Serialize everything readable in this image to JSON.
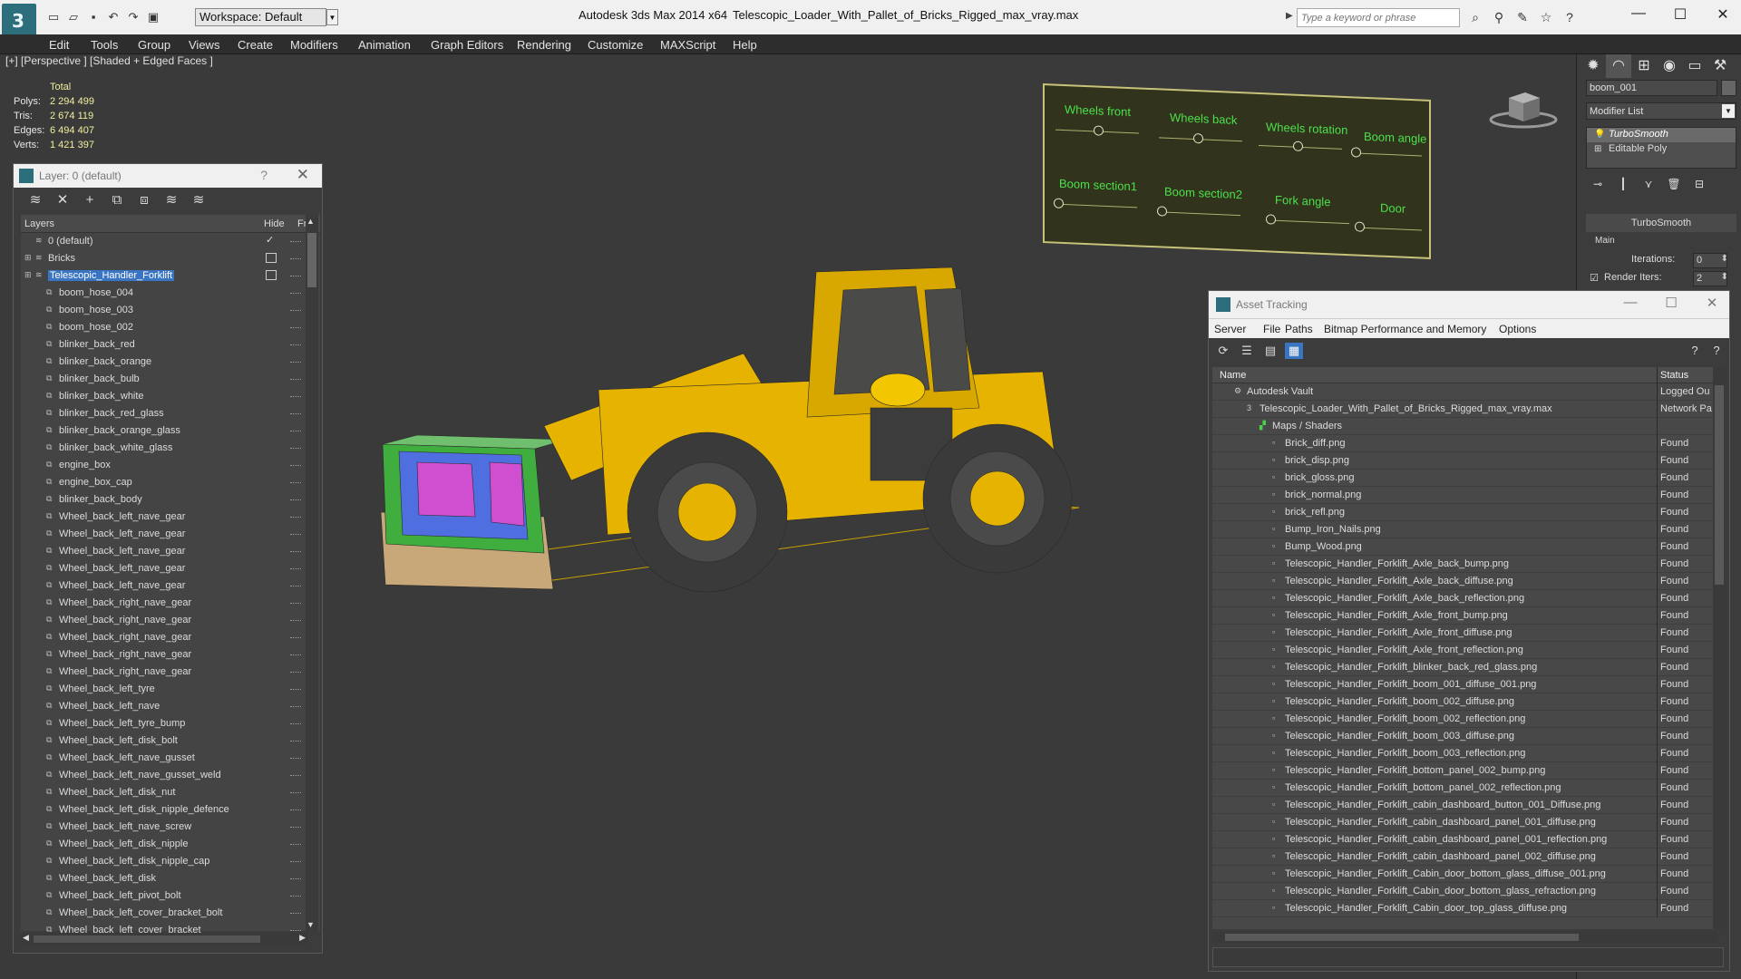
{
  "titlebar": {
    "workspace": "Workspace: Default",
    "app_title": "Autodesk 3ds Max  2014 x64",
    "file_title": "Telescopic_Loader_With_Pallet_of_Bricks_Rigged_max_vray.max",
    "search_placeholder": "Type a keyword or phrase"
  },
  "menu": [
    "Edit",
    "Tools",
    "Group",
    "Views",
    "Create",
    "Modifiers",
    "Animation",
    "Graph Editors",
    "Rendering",
    "Customize",
    "MAXScript",
    "Help"
  ],
  "viewport": {
    "label": "[+] [Perspective ] [Shaded + Edged Faces ]",
    "stats": {
      "header": "Total",
      "rows": [
        {
          "k": "Polys:",
          "v": "2 294 499"
        },
        {
          "k": "Tris:",
          "v": "2 674 119"
        },
        {
          "k": "Edges:",
          "v": "6 494 407"
        },
        {
          "k": "Verts:",
          "v": "1 421 397"
        }
      ]
    }
  },
  "rig_panel": {
    "labels": [
      "Wheels front",
      "Wheels back",
      "Wheels rotation",
      "Boom angle",
      "Boom section1",
      "Boom section2",
      "Fork angle",
      "Door"
    ]
  },
  "layer_dialog": {
    "title": "Layer: 0 (default)",
    "help": "?",
    "columns": {
      "layers": "Layers",
      "hide": "Hide",
      "freeze": "Fr"
    },
    "layers": [
      {
        "name": "0 (default)",
        "level": 0,
        "hide": "check"
      },
      {
        "name": "Bricks",
        "level": 0,
        "hide": "box",
        "expand": true
      },
      {
        "name": "Telescopic_Handler_Forklift",
        "level": 0,
        "hide": "box",
        "expand": true,
        "selected": true
      },
      {
        "name": "boom_hose_004",
        "level": 1
      },
      {
        "name": "boom_hose_003",
        "level": 1
      },
      {
        "name": "boom_hose_002",
        "level": 1
      },
      {
        "name": "blinker_back_red",
        "level": 1
      },
      {
        "name": "blinker_back_orange",
        "level": 1
      },
      {
        "name": "blinker_back_bulb",
        "level": 1
      },
      {
        "name": "blinker_back_white",
        "level": 1
      },
      {
        "name": "blinker_back_red_glass",
        "level": 1
      },
      {
        "name": "blinker_back_orange_glass",
        "level": 1
      },
      {
        "name": "blinker_back_white_glass",
        "level": 1
      },
      {
        "name": "engine_box",
        "level": 1
      },
      {
        "name": "engine_box_cap",
        "level": 1
      },
      {
        "name": "blinker_back_body",
        "level": 1
      },
      {
        "name": "Wheel_back_left_nave_gear",
        "level": 1
      },
      {
        "name": "Wheel_back_left_nave_gear",
        "level": 1
      },
      {
        "name": "Wheel_back_left_nave_gear",
        "level": 1
      },
      {
        "name": "Wheel_back_left_nave_gear",
        "level": 1
      },
      {
        "name": "Wheel_back_left_nave_gear",
        "level": 1
      },
      {
        "name": "Wheel_back_right_nave_gear",
        "level": 1
      },
      {
        "name": "Wheel_back_right_nave_gear",
        "level": 1
      },
      {
        "name": "Wheel_back_right_nave_gear",
        "level": 1
      },
      {
        "name": "Wheel_back_right_nave_gear",
        "level": 1
      },
      {
        "name": "Wheel_back_right_nave_gear",
        "level": 1
      },
      {
        "name": "Wheel_back_left_tyre",
        "level": 1
      },
      {
        "name": "Wheel_back_left_nave",
        "level": 1
      },
      {
        "name": "Wheel_back_left_tyre_bump",
        "level": 1
      },
      {
        "name": "Wheel_back_left_disk_bolt",
        "level": 1
      },
      {
        "name": "Wheel_back_left_nave_gusset",
        "level": 1
      },
      {
        "name": "Wheel_back_left_nave_gusset_weld",
        "level": 1
      },
      {
        "name": "Wheel_back_left_disk_nut",
        "level": 1
      },
      {
        "name": "Wheel_back_left_disk_nipple_defence",
        "level": 1
      },
      {
        "name": "Wheel_back_left_nave_screw",
        "level": 1
      },
      {
        "name": "Wheel_back_left_disk_nipple",
        "level": 1
      },
      {
        "name": "Wheel_back_left_disk_nipple_cap",
        "level": 1
      },
      {
        "name": "Wheel_back_left_disk",
        "level": 1
      },
      {
        "name": "Wheel_back_left_pivot_bolt",
        "level": 1
      },
      {
        "name": "Wheel_back_left_cover_bracket_bolt",
        "level": 1
      },
      {
        "name": "Wheel_back_left_cover_bracket",
        "level": 1
      }
    ]
  },
  "command_panel": {
    "object_name": "boom_001",
    "modifier_list": "Modifier List",
    "stack": [
      {
        "name": "TurboSmooth",
        "active": true
      },
      {
        "name": "Editable Poly",
        "active": false
      }
    ],
    "turbosmooth": {
      "rollout": "TurboSmooth",
      "main_label": "Main",
      "iterations_label": "Iterations:",
      "iterations": "0",
      "render_iters_label": "Render Iters:",
      "render_iters": "2"
    }
  },
  "asset_tracking": {
    "title": "Asset Tracking",
    "menu": [
      "Server",
      "File",
      "Paths",
      "Bitmap Performance and Memory",
      "Options"
    ],
    "columns": {
      "name": "Name",
      "status": "Status"
    },
    "rows": [
      {
        "name": "Autodesk Vault",
        "level": 0,
        "status": "Logged Ou",
        "icon": "vault"
      },
      {
        "name": "Telescopic_Loader_With_Pallet_of_Bricks_Rigged_max_vray.max",
        "level": 1,
        "status": "Network Pa",
        "icon": "max"
      },
      {
        "name": "Maps / Shaders",
        "level": 2,
        "status": "",
        "icon": "maps"
      },
      {
        "name": "Brick_diff.png",
        "level": 3,
        "status": "Found"
      },
      {
        "name": "brick_disp.png",
        "level": 3,
        "status": "Found"
      },
      {
        "name": "brick_gloss.png",
        "level": 3,
        "status": "Found"
      },
      {
        "name": "brick_normal.png",
        "level": 3,
        "status": "Found"
      },
      {
        "name": "brick_refl.png",
        "level": 3,
        "status": "Found"
      },
      {
        "name": "Bump_Iron_Nails.png",
        "level": 3,
        "status": "Found"
      },
      {
        "name": "Bump_Wood.png",
        "level": 3,
        "status": "Found"
      },
      {
        "name": "Telescopic_Handler_Forklift_Axle_back_bump.png",
        "level": 3,
        "status": "Found"
      },
      {
        "name": "Telescopic_Handler_Forklift_Axle_back_diffuse.png",
        "level": 3,
        "status": "Found"
      },
      {
        "name": "Telescopic_Handler_Forklift_Axle_back_reflection.png",
        "level": 3,
        "status": "Found"
      },
      {
        "name": "Telescopic_Handler_Forklift_Axle_front_bump.png",
        "level": 3,
        "status": "Found"
      },
      {
        "name": "Telescopic_Handler_Forklift_Axle_front_diffuse.png",
        "level": 3,
        "status": "Found"
      },
      {
        "name": "Telescopic_Handler_Forklift_Axle_front_reflection.png",
        "level": 3,
        "status": "Found"
      },
      {
        "name": "Telescopic_Handler_Forklift_blinker_back_red_glass.png",
        "level": 3,
        "status": "Found"
      },
      {
        "name": "Telescopic_Handler_Forklift_boom_001_diffuse_001.png",
        "level": 3,
        "status": "Found"
      },
      {
        "name": "Telescopic_Handler_Forklift_boom_002_diffuse.png",
        "level": 3,
        "status": "Found"
      },
      {
        "name": "Telescopic_Handler_Forklift_boom_002_reflection.png",
        "level": 3,
        "status": "Found"
      },
      {
        "name": "Telescopic_Handler_Forklift_boom_003_diffuse.png",
        "level": 3,
        "status": "Found"
      },
      {
        "name": "Telescopic_Handler_Forklift_boom_003_reflection.png",
        "level": 3,
        "status": "Found"
      },
      {
        "name": "Telescopic_Handler_Forklift_bottom_panel_002_bump.png",
        "level": 3,
        "status": "Found"
      },
      {
        "name": "Telescopic_Handler_Forklift_bottom_panel_002_reflection.png",
        "level": 3,
        "status": "Found"
      },
      {
        "name": "Telescopic_Handler_Forklift_cabin_dashboard_button_001_Diffuse.png",
        "level": 3,
        "status": "Found"
      },
      {
        "name": "Telescopic_Handler_Forklift_cabin_dashboard_panel_001_diffuse.png",
        "level": 3,
        "status": "Found"
      },
      {
        "name": "Telescopic_Handler_Forklift_cabin_dashboard_panel_001_reflection.png",
        "level": 3,
        "status": "Found"
      },
      {
        "name": "Telescopic_Handler_Forklift_cabin_dashboard_panel_002_diffuse.png",
        "level": 3,
        "status": "Found"
      },
      {
        "name": "Telescopic_Handler_Forklift_Cabin_door_bottom_glass_diffuse_001.png",
        "level": 3,
        "status": "Found"
      },
      {
        "name": "Telescopic_Handler_Forklift_Cabin_door_bottom_glass_refraction.png",
        "level": 3,
        "status": "Found"
      },
      {
        "name": "Telescopic_Handler_Forklift_Cabin_door_top_glass_diffuse.png",
        "level": 3,
        "status": "Found"
      }
    ]
  },
  "colors": {
    "viewport_bg": "#3a3a3a",
    "rig_label": "#4be04b",
    "machine_yellow": "#e6b400",
    "selection_blue": "#3a75c4"
  }
}
